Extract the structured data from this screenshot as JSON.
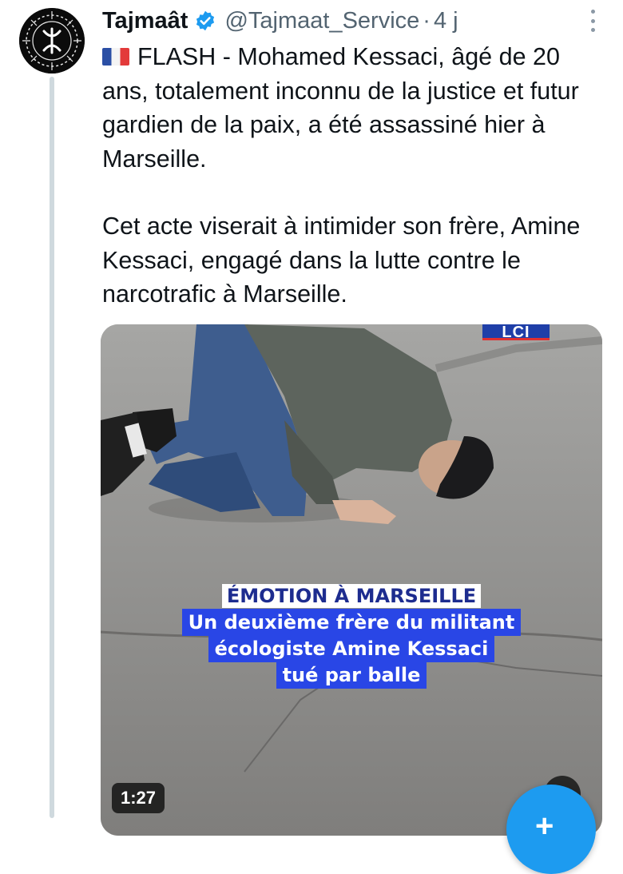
{
  "tweet": {
    "author_name": "Tajmaât",
    "handle": "@Tajmaat_Service",
    "separator": "·",
    "time": "4 j",
    "flag_icon": "france-flag-icon",
    "paragraph1": "FLASH - Mohamed Kessaci, âgé de 20 ans, totalement inconnu de la justice et futur gardien de la paix, a été assassiné hier à Marseille.",
    "paragraph2": "Cet acte viserait à intimider son frère, Amine Kessaci, engagé dans la lutte contre le narcotrafic à Marseille."
  },
  "media": {
    "channel_logo": "LCI",
    "caption_title": "ÉMOTION À MARSEILLE",
    "caption_lines": [
      "Un deuxième frère du militant",
      "écologiste Amine Kessaci",
      "tué par balle"
    ],
    "duration": "1:27"
  },
  "colors": {
    "verified": "#1d9bf0",
    "caption_blue": "#2946e6",
    "caption_title_text": "#1d2c8f",
    "fab": "#1d9bf0"
  }
}
